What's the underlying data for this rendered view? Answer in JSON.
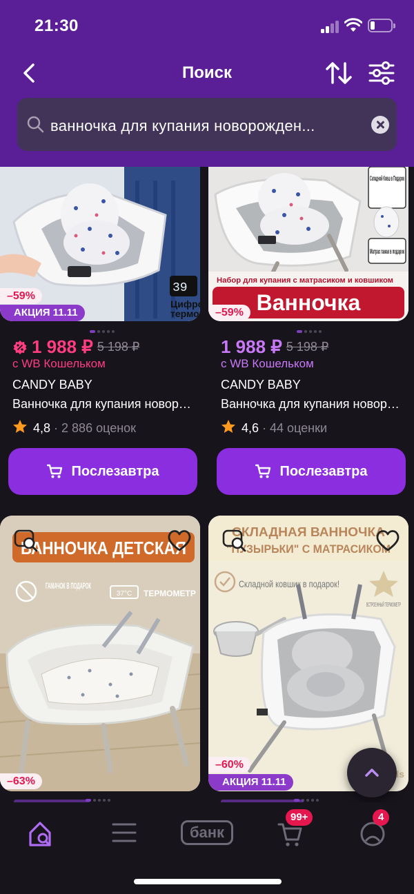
{
  "status_bar": {
    "time": "21:30"
  },
  "nav": {
    "title": "Поиск"
  },
  "search": {
    "value": "ванночка для купания новорожден..."
  },
  "products": [
    {
      "image_text_1": "Цифро",
      "image_text_2": "термо",
      "thermo_readout": "39",
      "discount": "–59%",
      "promo": "АКЦИЯ 11.11",
      "price": "1 988 ₽",
      "old_price": "5 198 ₽",
      "wallet": "с WB Кошельком",
      "brand": "CANDY BABY",
      "name": "Ванночка для купания новорожденных",
      "rating": "4,8",
      "reviews": "2 886 оценок",
      "button": "Послезавтра"
    },
    {
      "image_banner": "Ванночка",
      "image_subtitle": "Набор для купания с матрасиком и ковшиком",
      "image_side_1": "Складной Ковш в Подарок",
      "image_side_2": "Матрас гамак в подарок",
      "discount": "–59%",
      "price": "1 988 ₽",
      "old_price": "5 198 ₽",
      "wallet": "с WB Кошельком",
      "brand": "CANDY BABY",
      "name": "Ванночка для купания новорожденных",
      "rating": "4,6",
      "reviews": "44 оценки",
      "button": "Послезавтра"
    },
    {
      "image_banner": "ВАННОЧКА ДЕТСКАЯ",
      "image_feature_1": "ГАМАЧОК В ПОДАРОК",
      "image_feature_2": "ТЕРМОМЕТР",
      "image_feature_2_badge": "37°C",
      "discount": "–63%"
    },
    {
      "image_banner_1": "СКЛАДНАЯ ВАННОЧКА",
      "image_banner_2": "\"ПУЗЫРЬКИ\" С МАТРАСИКОМ",
      "image_feature_1": "Складной ковшик в подарок!",
      "image_feature_2": "ВСТРОЕННЫЙ ТЕРМОМЕТР",
      "discount": "–60%",
      "promo": "АКЦИЯ 11.11"
    }
  ],
  "bottom_nav": {
    "bank_label": "банк",
    "cart_badge": "99+",
    "profile_badge": "4"
  },
  "colors": {
    "header": "#5a1e96",
    "accent": "#8a2ee0",
    "price": "#c879f7",
    "discount": "#e5174f",
    "background": "#17141c"
  }
}
